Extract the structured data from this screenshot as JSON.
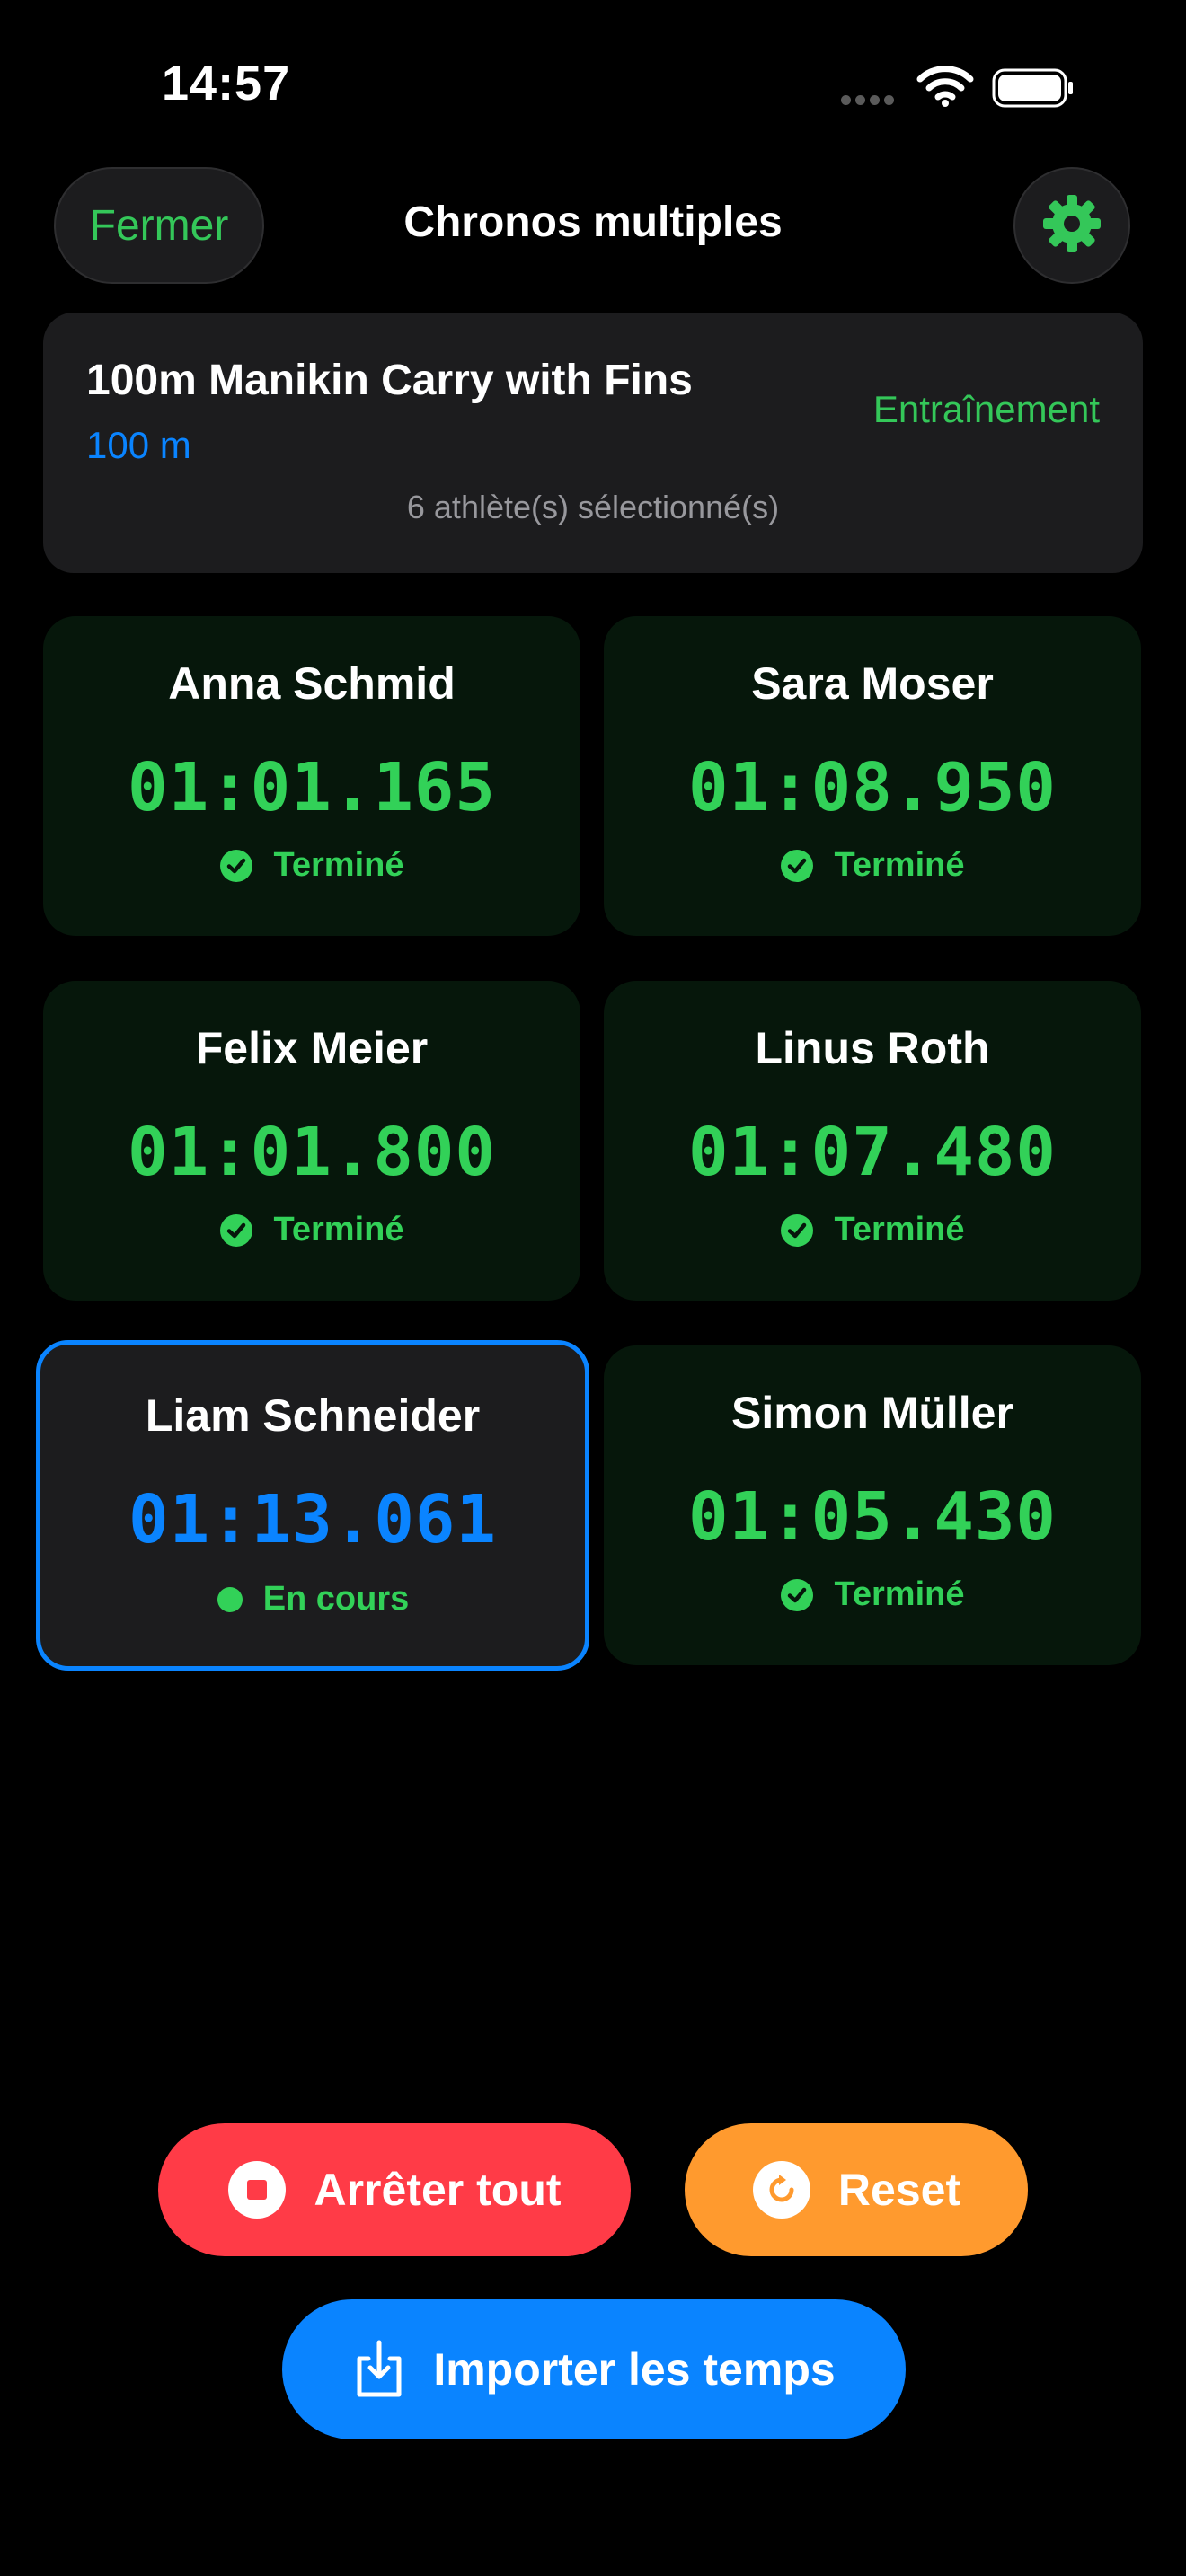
{
  "status_bar": {
    "time": "14:57"
  },
  "header": {
    "close_label": "Fermer",
    "title": "Chronos multiples"
  },
  "event": {
    "name": "100m Manikin Carry with Fins",
    "distance": "100 m",
    "mode": "Entraînement",
    "selected_count": "6 athlète(s) sélectionné(s)"
  },
  "athletes": [
    {
      "name": "Anna Schmid",
      "time": "01:01.165",
      "status": "Terminé"
    },
    {
      "name": "Sara Moser",
      "time": "01:08.950",
      "status": "Terminé"
    },
    {
      "name": "Felix Meier",
      "time": "01:01.800",
      "status": "Terminé"
    },
    {
      "name": "Linus Roth",
      "time": "01:07.480",
      "status": "Terminé"
    },
    {
      "name": "Liam Schneider",
      "time": "01:13.061",
      "status": "En cours"
    },
    {
      "name": "Simon Müller",
      "time": "01:05.430",
      "status": "Terminé"
    }
  ],
  "actions": {
    "stop_all": "Arrêter tout",
    "reset": "Reset",
    "import": "Importer les temps"
  },
  "colors": {
    "accent_green": "#34c759",
    "accent_blue": "#0a84ff",
    "stop_red": "#ff3b47",
    "reset_orange": "#ff9a2e"
  }
}
